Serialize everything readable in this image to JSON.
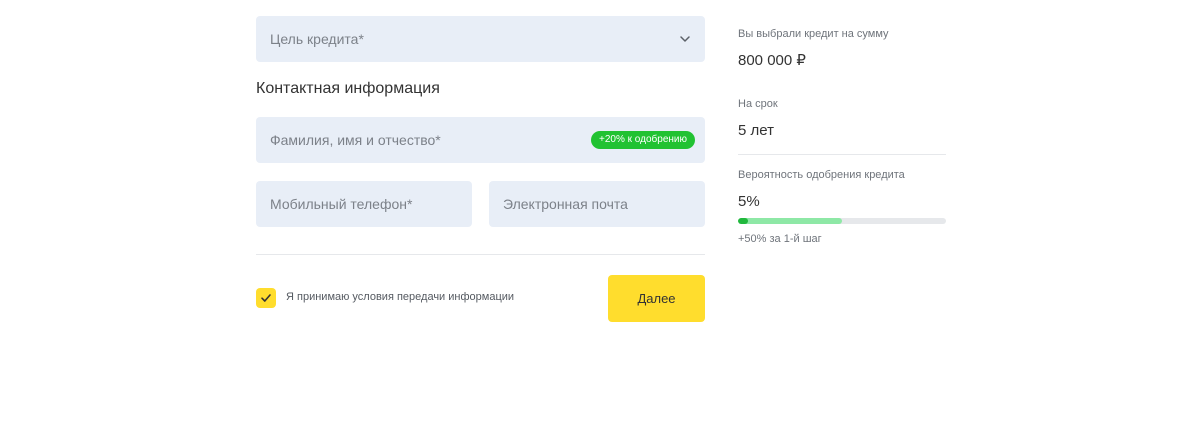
{
  "form": {
    "purpose_placeholder": "Цель кредита*",
    "section_title": "Контактная информация",
    "fullname_placeholder": "Фамилия, имя и отчество*",
    "fullname_badge": "+20% к одобрению",
    "phone_placeholder": "Мобильный телефон*",
    "email_placeholder": "Электронная почта",
    "consent_label": "Я принимаю условия передачи информации",
    "consent_checked": true,
    "next_label": "Далее",
    "icons": {
      "purpose_dropdown": "chevron-down-icon",
      "consent": "checkmark-icon"
    }
  },
  "summary": {
    "amount_label": "Вы выбрали кредит на сумму",
    "amount_value": "800 000 ₽",
    "term_label": "На срок",
    "term_value": "5 лет",
    "approval_label": "Вероятность одобрения кредита",
    "approval_value": "5%",
    "approval_fraction": 0.05,
    "approval_bonus_fraction": 0.5,
    "approval_note": "+50% за 1-й шаг"
  },
  "colors": {
    "accent_yellow": "#ffdd2d",
    "badge_green": "#21c232",
    "progress_green": "#21b83d",
    "progress_bonus": "#8ee8a6",
    "field_bg": "#e8eef7"
  }
}
